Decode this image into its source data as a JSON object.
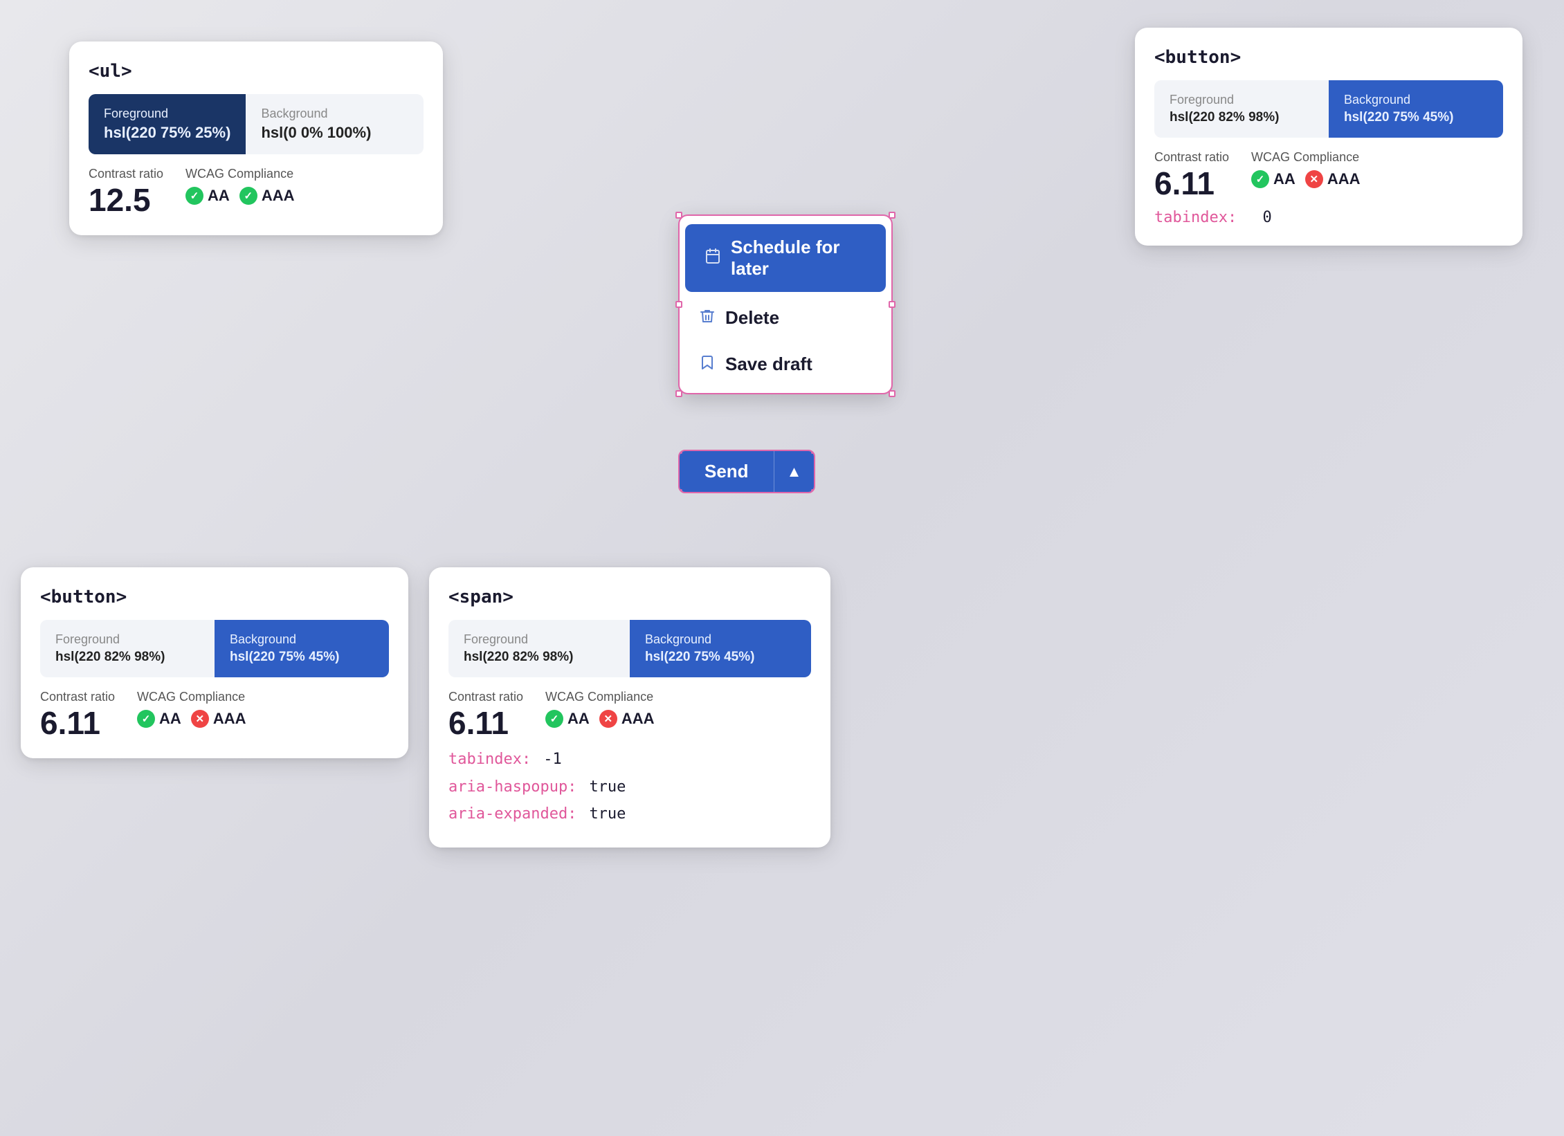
{
  "cards": {
    "top_left": {
      "tag": "<ul>",
      "swatches": [
        {
          "type": "dark",
          "label": "Foreground",
          "value": "hsl(220 75% 25%)"
        },
        {
          "type": "light",
          "label": "Background",
          "value": "hsl(0 0% 100%)"
        }
      ],
      "contrast_label": "Contrast ratio",
      "contrast_value": "12.5",
      "wcag_label": "WCAG Compliance",
      "aa_pass": true,
      "aaa_pass": true
    },
    "top_right": {
      "tag": "<button>",
      "swatches": [
        {
          "type": "light",
          "label": "Foreground",
          "value": "hsl(220 82% 98%)"
        },
        {
          "type": "blue",
          "label": "Background",
          "value": "hsl(220 75% 45%)"
        }
      ],
      "contrast_label": "Contrast ratio",
      "contrast_value": "6.11",
      "wcag_label": "WCAG Compliance",
      "aa_pass": true,
      "aaa_pass": false,
      "tabindex_label": "tabindex:",
      "tabindex_value": "0"
    },
    "bottom_left": {
      "tag": "<button>",
      "swatches": [
        {
          "type": "light",
          "label": "Foreground",
          "value": "hsl(220 82% 98%)"
        },
        {
          "type": "blue",
          "label": "Background",
          "value": "hsl(220 75% 45%)"
        }
      ],
      "contrast_label": "Contrast ratio",
      "contrast_value": "6.11",
      "wcag_label": "WCAG Compliance",
      "aa_pass": true,
      "aaa_pass": false
    },
    "bottom_right": {
      "tag": "<span>",
      "swatches": [
        {
          "type": "light",
          "label": "Foreground",
          "value": "hsl(220 82% 98%)"
        },
        {
          "type": "blue",
          "label": "Background",
          "value": "hsl(220 75% 45%)"
        }
      ],
      "contrast_label": "Contrast ratio",
      "contrast_value": "6.11",
      "wcag_label": "WCAG Compliance",
      "aa_pass": true,
      "aaa_pass": false,
      "aria_attrs": [
        {
          "name": "tabindex:",
          "value": "-1"
        },
        {
          "name": "aria-haspopup:",
          "value": "true"
        },
        {
          "name": "aria-expanded:",
          "value": "true"
        }
      ]
    }
  },
  "dropdown": {
    "items": [
      {
        "id": "schedule",
        "label": "Schedule for later",
        "icon": "calendar",
        "active": true
      },
      {
        "id": "delete",
        "label": "Delete",
        "icon": "trash",
        "active": false
      },
      {
        "id": "save_draft",
        "label": "Save draft",
        "icon": "bookmark",
        "active": false
      }
    ]
  },
  "send_button": {
    "main_label": "Send",
    "chevron": "▲"
  },
  "icons": {
    "calendar": "📅",
    "trash": "🗑",
    "bookmark": "🔖",
    "check": "✓",
    "cross": "✕"
  }
}
